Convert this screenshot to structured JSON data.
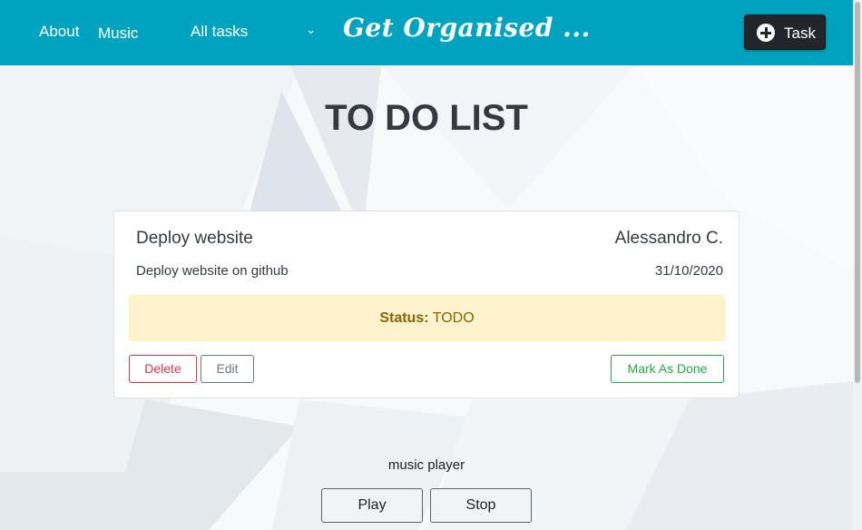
{
  "nav": {
    "about": "About",
    "music": "Music",
    "filter_selected": "All tasks",
    "brand": "Get Organised ...",
    "add_task_label": "Task",
    "add_task_icon": "plus-circle-icon",
    "select_icon": "chevron-down-icon"
  },
  "page": {
    "title": "TO DO LIST"
  },
  "task": {
    "title": "Deploy website",
    "author": "Alessandro C.",
    "description": "Deploy website on github",
    "date": "31/10/2020",
    "status_key": "Status:",
    "status_value": "TODO",
    "delete_label": "Delete",
    "edit_label": "Edit",
    "done_label": "Mark As Done"
  },
  "music": {
    "label": "music player",
    "play_label": "Play",
    "stop_label": "Stop"
  },
  "colors": {
    "navbar": "#00a3bf",
    "dark_button": "#22262b",
    "status_bg": "#fff3cd",
    "status_text": "#856404",
    "danger": "#dc3545",
    "secondary": "#6c757d",
    "success": "#28a745"
  }
}
